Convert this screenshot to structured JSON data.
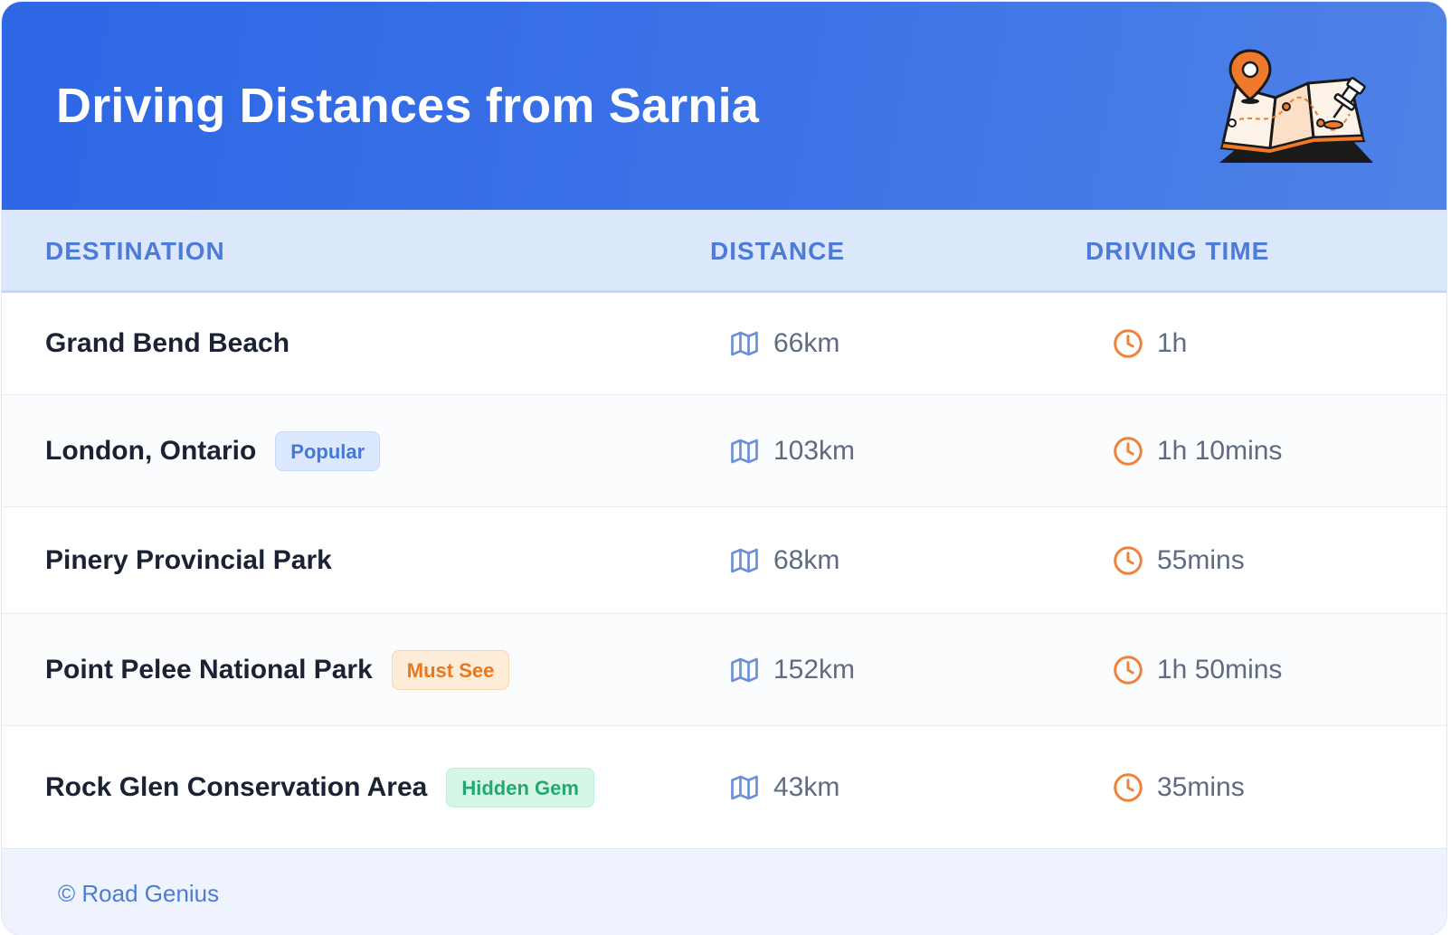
{
  "header": {
    "title": "Driving Distances from Sarnia",
    "illustration": "map-with-pin-illustration"
  },
  "table": {
    "columns": [
      "DESTINATION",
      "DISTANCE",
      "DRIVING TIME"
    ],
    "rows": [
      {
        "destination": "Grand Bend Beach",
        "badge": "",
        "distance": "66km",
        "time": "1h"
      },
      {
        "destination": "London, Ontario",
        "badge": "Popular",
        "badge_color": "#4577d8",
        "distance": "103km",
        "time": "1h 10mins"
      },
      {
        "destination": "Pinery Provincial Park",
        "badge": "",
        "distance": "68km",
        "time": "55mins"
      },
      {
        "destination": "Point Pelee National Park",
        "badge": "Must See",
        "badge_color": "#e8781f",
        "distance": "152km",
        "time": "1h 50mins"
      },
      {
        "destination": "Rock Glen Conservation Area",
        "badge": "Hidden Gem",
        "badge_color": "#25a870",
        "distance": "43km",
        "time": "35mins"
      }
    ],
    "distance_icon": "map-icon",
    "time_icon": "clock-icon"
  },
  "footer": {
    "text": "© Road Genius"
  },
  "colors": {
    "header_start": "#2d67e6",
    "header_end": "#4f82e6",
    "accent_blue": "#4d7bd6",
    "accent_orange": "#f0813a"
  }
}
